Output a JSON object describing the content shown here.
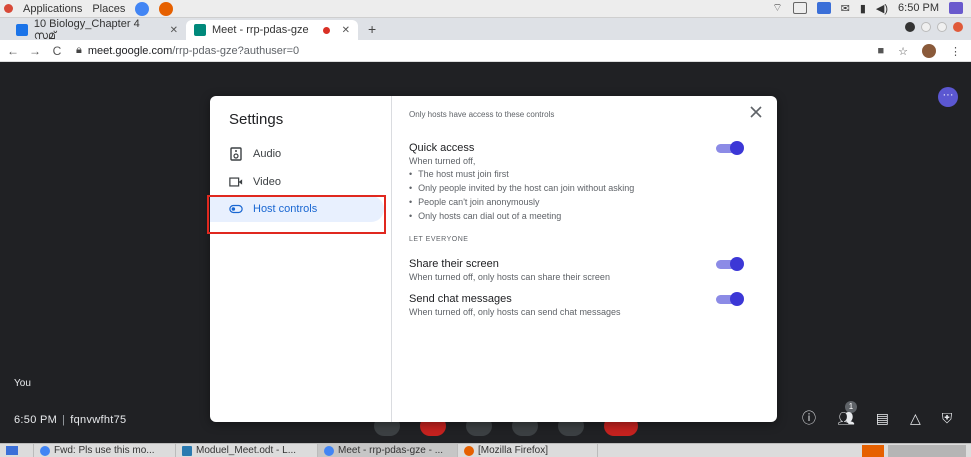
{
  "os_bar": {
    "applications": "Applications",
    "places": "Places",
    "clock": "6:50 PM"
  },
  "browser": {
    "tabs": [
      {
        "label": "10 Biology_Chapter 4 സമ്"
      },
      {
        "label": "Meet - rrp-pdas-gze"
      }
    ],
    "url_host": "meet.google.com",
    "url_path": "/rrp-pdas-gze?authuser=0"
  },
  "meet": {
    "you_label": "You",
    "time": "6:50 PM",
    "meeting_code": "fqnvwfht75",
    "participants_badge": "1"
  },
  "settings": {
    "title": "Settings",
    "menu": [
      {
        "label": "Audio",
        "icon": "speaker-icon"
      },
      {
        "label": "Video",
        "icon": "video-camera-icon"
      },
      {
        "label": "Host controls",
        "icon": "toggle-icon",
        "selected": true
      }
    ],
    "note": "Only hosts have access to these controls",
    "quick_access": {
      "title": "Quick access",
      "subtitle": "When turned off,",
      "bullets": [
        "The host must join first",
        "Only people invited by the host can join without asking",
        "People can't join anonymously",
        "Only hosts can dial out of a meeting"
      ],
      "enabled": true
    },
    "let_everyone": "LET EVERYONE",
    "share_screen": {
      "title": "Share their screen",
      "subtitle": "When turned off, only hosts can share their screen",
      "enabled": true
    },
    "chat": {
      "title": "Send chat messages",
      "subtitle": "When turned off, only hosts can send chat messages",
      "enabled": true
    },
    "accent_color": "#3c37d6"
  },
  "taskbar": {
    "items": [
      {
        "label": "Fwd: Pls use this mo..."
      },
      {
        "label": "Moduel_Meet.odt - L..."
      },
      {
        "label": "Meet - rrp-pdas-gze - ..."
      },
      {
        "label": "[Mozilla Firefox]"
      }
    ]
  }
}
